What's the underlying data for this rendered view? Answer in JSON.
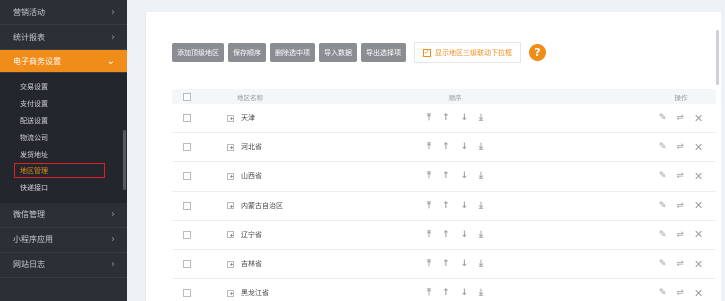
{
  "sidebar": {
    "top_items": [
      {
        "label": "营销活动"
      },
      {
        "label": "统计报表"
      }
    ],
    "active": {
      "label": "电子商务设置"
    },
    "sub_items": [
      {
        "label": "交易设置"
      },
      {
        "label": "支付设置"
      },
      {
        "label": "配送设置"
      },
      {
        "label": "物流公司"
      },
      {
        "label": "发货地址"
      },
      {
        "label": "地区管理"
      },
      {
        "label": "快递接口"
      }
    ],
    "bottom_items": [
      {
        "label": "微信管理"
      },
      {
        "label": "小程序应用"
      },
      {
        "label": "网站日志"
      }
    ],
    "accent_color": "#f08c1a"
  },
  "toolbar": {
    "add_label": "添加顶级地区",
    "save_order_label": "保存顺序",
    "delete_label": "删除选中项",
    "import_label": "导入数据",
    "export_label": "导出选择项",
    "linkage_label": "显示地区三级联动下拉框",
    "linkage_checked": true,
    "help_label": "?"
  },
  "table": {
    "headers": {
      "name": "地区名称",
      "order": "顺序",
      "ops": "操作"
    },
    "rows": [
      {
        "name": "天津"
      },
      {
        "name": "河北省"
      },
      {
        "name": "山西省"
      },
      {
        "name": "内蒙古自治区"
      },
      {
        "name": "辽宁省"
      },
      {
        "name": "吉林省"
      },
      {
        "name": "黑龙江省"
      }
    ]
  },
  "icons": {
    "chevron": "›",
    "chevron_down": "⌄",
    "top": "⤒",
    "up": "↑",
    "down": "↓",
    "bottom": "⤓",
    "edit": "✎",
    "move": "⇌",
    "close": "✕",
    "check": "✓"
  }
}
